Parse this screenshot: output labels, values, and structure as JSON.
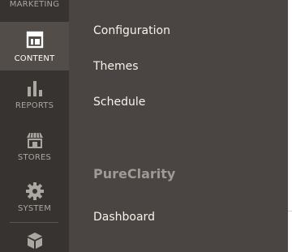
{
  "sidebar": {
    "items": [
      {
        "label": "MARKETING",
        "icon": "megaphone-icon"
      },
      {
        "label": "CONTENT",
        "icon": "content-layout-icon",
        "active": true
      },
      {
        "label": "REPORTS",
        "icon": "bar-chart-icon"
      },
      {
        "label": "STORES",
        "icon": "storefront-icon"
      },
      {
        "label": "SYSTEM",
        "icon": "gear-icon"
      },
      {
        "label": "",
        "icon": "extension-box-icon"
      }
    ]
  },
  "submenu": {
    "links": [
      "Configuration",
      "Themes",
      "Schedule"
    ],
    "section_title": "PureClarity",
    "section_links": [
      "Dashboard"
    ]
  },
  "colors": {
    "sidebar_bg": "#373330",
    "sidebar_active_bg": "#524d49",
    "submenu_bg": "#4a4542",
    "link_text": "#f7f3eb",
    "section_title": "#9e9a95",
    "sidebar_text": "#aaa6a0"
  }
}
